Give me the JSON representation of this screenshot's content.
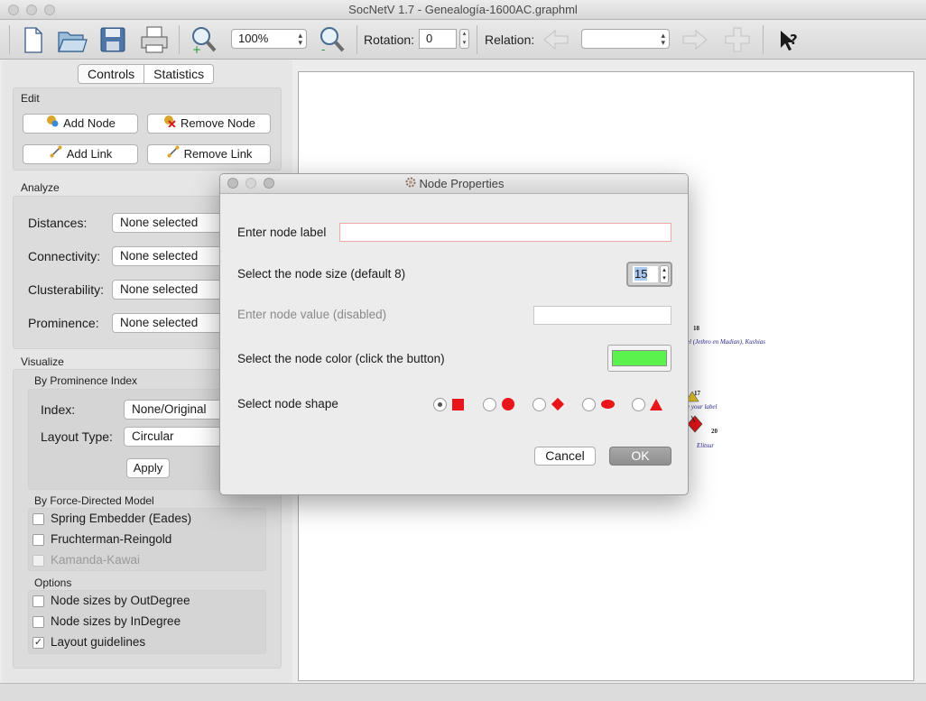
{
  "window": {
    "title": "SocNetV 1.7 - Genealogía-1600AC.graphml"
  },
  "toolbar": {
    "zoom_value": "100%",
    "rotation_label": "Rotation:",
    "rotation_value": "0",
    "relation_label": "Relation:",
    "relation_value": "",
    "icons": [
      "new-file-icon",
      "open-folder-icon",
      "save-icon",
      "print-icon",
      "zoom-in-icon",
      "zoom-out-icon",
      "previous-relation-icon",
      "next-relation-icon",
      "add-relation-icon",
      "whats-this-help-icon"
    ]
  },
  "left_panel": {
    "tabs": [
      "Controls",
      "Statistics"
    ],
    "edit": {
      "title": "Edit",
      "add_node": "Add Node",
      "remove_node": "Remove Node",
      "add_link": "Add Link",
      "remove_link": "Remove Link"
    },
    "analyze": {
      "title": "Analyze",
      "rows": [
        {
          "label": "Distances:",
          "value": "None selected"
        },
        {
          "label": "Connectivity:",
          "value": "None selected"
        },
        {
          "label": "Clusterability:",
          "value": "None selected"
        },
        {
          "label": "Prominence:",
          "value": "None selected"
        }
      ]
    },
    "visualize": {
      "title": "Visualize",
      "by_prominence_title": "By Prominence Index",
      "index_label": "Index:",
      "index_value": "None/Original",
      "layout_label": "Layout Type:",
      "layout_value": "Circular",
      "apply": "Apply",
      "force_title": "By Force-Directed Model",
      "force_options": [
        {
          "label": "Spring Embedder (Eades)",
          "checked": false,
          "enabled": true
        },
        {
          "label": "Fruchterman-Reingold",
          "checked": false,
          "enabled": true
        },
        {
          "label": "Kamanda-Kawai",
          "checked": false,
          "enabled": false
        }
      ],
      "options_title": "Options",
      "options": [
        {
          "label": "Node sizes by OutDegree",
          "checked": false
        },
        {
          "label": "Node sizes by InDegree",
          "checked": false
        },
        {
          "label": "Layout guidelines",
          "checked": true
        }
      ]
    }
  },
  "canvas": {
    "labels": [
      {
        "num": "18",
        "text": "el (Jethro en Madian), Kushias"
      },
      {
        "num": "17",
        "text": "e your label"
      },
      {
        "num": "20",
        "text": "Elitsur"
      }
    ]
  },
  "dialog": {
    "title": "Node Properties",
    "label_prompt": "Enter node label",
    "label_value": "",
    "size_prompt": "Select the node size (default 8)",
    "size_value": "15",
    "value_prompt": "Enter node value (disabled)",
    "color_prompt": "Select the node color (click the button)",
    "color": "#5cf24e",
    "shape_prompt": "Select node shape",
    "shapes": [
      "box",
      "circle",
      "diamond",
      "ellipse",
      "triangle"
    ],
    "selected_shape": "box",
    "shape_color": "#e8161a",
    "cancel": "Cancel",
    "ok": "OK"
  }
}
